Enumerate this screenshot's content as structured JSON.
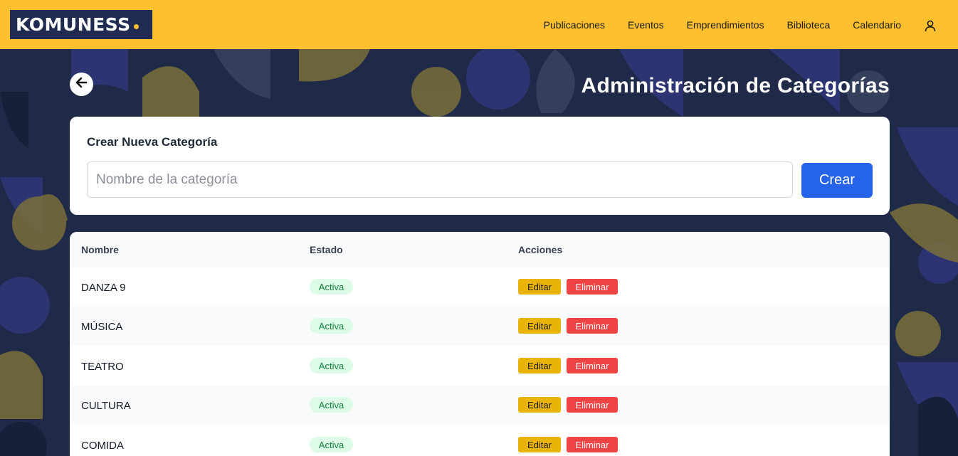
{
  "navbar": {
    "logo_text": "KOMUNESS",
    "links": [
      "Publicaciones",
      "Eventos",
      "Emprendimientos",
      "Biblioteca",
      "Calendario"
    ],
    "user_icon": "user-icon"
  },
  "page": {
    "title": "Administración de Categorías",
    "back_icon": "arrow-left-icon"
  },
  "create": {
    "title": "Crear Nueva Categoría",
    "placeholder": "Nombre de la categoría",
    "value": "",
    "button_label": "Crear"
  },
  "table": {
    "headers": [
      "Nombre",
      "Estado",
      "Acciones"
    ],
    "rows": [
      {
        "name": "DANZA 9",
        "status": "Activa",
        "edit": "Editar",
        "delete": "Eliminar"
      },
      {
        "name": "MÚSICA",
        "status": "Activa",
        "edit": "Editar",
        "delete": "Eliminar"
      },
      {
        "name": "TEATRO",
        "status": "Activa",
        "edit": "Editar",
        "delete": "Eliminar"
      },
      {
        "name": "CULTURA",
        "status": "Activa",
        "edit": "Editar",
        "delete": "Eliminar"
      },
      {
        "name": "COMIDA",
        "status": "Activa",
        "edit": "Editar",
        "delete": "Eliminar"
      }
    ]
  },
  "colors": {
    "navbar": "#fec02f",
    "logo_bg": "#1f2b50",
    "background": "#1f2a48",
    "primary_button": "#2563eb",
    "edit_button": "#eab308",
    "delete_button": "#ef4444",
    "badge_bg": "#dcfce7",
    "badge_text": "#15803d"
  }
}
